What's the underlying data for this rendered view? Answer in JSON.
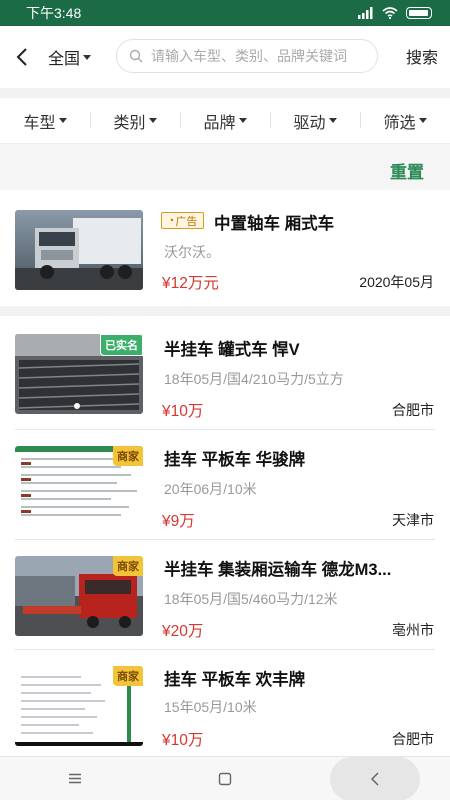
{
  "status_bar": {
    "time": "下午3:48"
  },
  "header": {
    "region": "全国",
    "search_placeholder": "请输入车型、类别、品牌关键词",
    "search_button": "搜索"
  },
  "filters": [
    {
      "label": "车型"
    },
    {
      "label": "类别"
    },
    {
      "label": "品牌"
    },
    {
      "label": "驱动"
    },
    {
      "label": "筛选"
    }
  ],
  "reset_label": "重置",
  "listings": [
    {
      "ad_label": "广告",
      "title": "中置轴车 厢式车",
      "subtitle": "沃尔沃。",
      "price": "¥12万元",
      "right_text": "2020年05月"
    },
    {
      "tag": "已实名",
      "title": "半挂车 罐式车 悍V",
      "subtitle": "18年05月/国4/210马力/5立方",
      "price": "¥10万",
      "right_text": "合肥市"
    },
    {
      "tag": "商家",
      "title": "挂车 平板车 华骏牌",
      "subtitle": "20年06月/10米",
      "price": "¥9万",
      "right_text": "天津市"
    },
    {
      "tag": "商家",
      "title": "半挂车 集装厢运输车 德龙M3...",
      "subtitle": "18年05月/国5/460马力/12米",
      "price": "¥20万",
      "right_text": "亳州市"
    },
    {
      "tag": "商家",
      "title": "挂车 平板车 欢丰牌",
      "subtitle": "15年05月/10米",
      "price": "¥10万",
      "right_text": "合肥市"
    }
  ],
  "colors": {
    "status_bar": "#1b6b46",
    "accent_green": "#2b8a57",
    "price_red": "#d6372f",
    "merchant_tag": "#f3c43a",
    "verified_tag": "#3cb06a"
  }
}
